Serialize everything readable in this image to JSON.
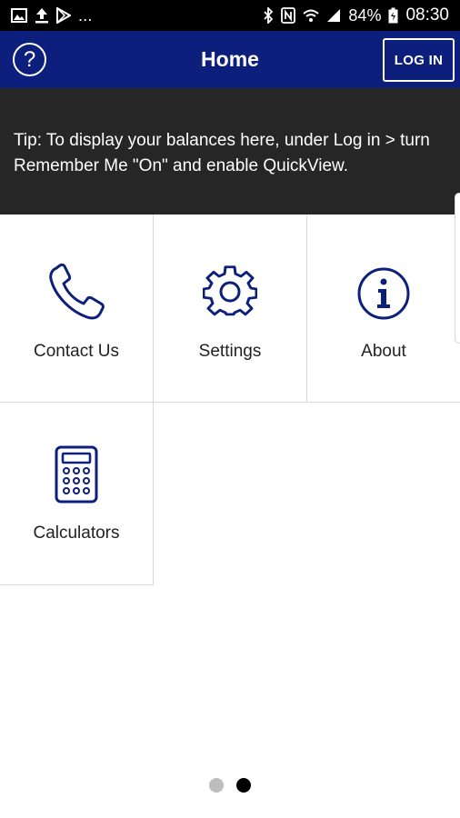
{
  "status_bar": {
    "left_icons": [
      "image-icon",
      "upload-icon",
      "play-store-icon"
    ],
    "more": "...",
    "right_icons": [
      "bluetooth-icon",
      "nfc-icon",
      "wifi-icon",
      "signal-icon"
    ],
    "battery": "84%",
    "time": "08:30"
  },
  "app_bar": {
    "title": "Home",
    "help_label": "?",
    "login_label": "LOG IN",
    "background_color": "#0d1f7c"
  },
  "tip": {
    "text": "Tip: To display your balances here, under Log in > turn Remember Me \"On\" and enable QuickView."
  },
  "tiles": [
    {
      "label": "Contact Us",
      "icon": "phone-icon"
    },
    {
      "label": "Settings",
      "icon": "gear-icon"
    },
    {
      "label": "About",
      "icon": "info-icon"
    },
    {
      "label": "Calculators",
      "icon": "calculator-icon"
    }
  ],
  "pager": {
    "count": 2,
    "active_index": 1
  },
  "colors": {
    "accent": "#0d1f7c",
    "tip_bg": "#262626"
  }
}
